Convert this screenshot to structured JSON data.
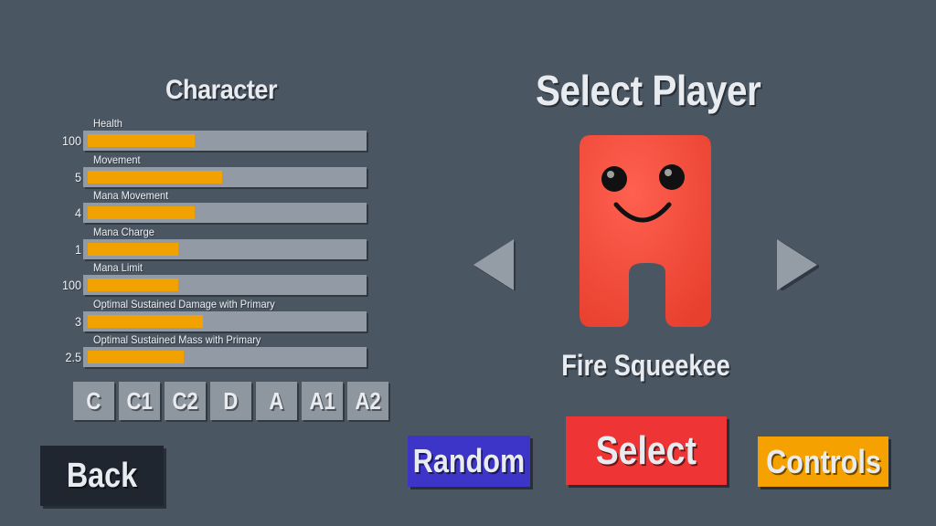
{
  "left_panel": {
    "title": "Character",
    "stats": [
      {
        "label": "Health",
        "value": "100",
        "fill": 0.39
      },
      {
        "label": "Movement",
        "value": "5",
        "fill": 0.49
      },
      {
        "label": "Mana Movement",
        "value": "4",
        "fill": 0.39
      },
      {
        "label": "Mana Charge",
        "value": "1",
        "fill": 0.33
      },
      {
        "label": "Mana Limit",
        "value": "100",
        "fill": 0.33
      },
      {
        "label": "Optimal Sustained Damage with Primary",
        "value": "3",
        "fill": 0.42
      },
      {
        "label": "Optimal Sustained Mass with Primary",
        "value": "2.5",
        "fill": 0.35
      }
    ],
    "tabs": [
      "C",
      "C1",
      "C2",
      "D",
      "A",
      "A1",
      "A2"
    ]
  },
  "back_button": {
    "label": "Back"
  },
  "right_panel": {
    "title": "Select Player",
    "character_name": "Fire Squeekee",
    "prev_icon": "triangle-left-icon",
    "next_icon": "triangle-right-icon"
  },
  "actions": {
    "random_label": "Random",
    "select_label": "Select",
    "controls_label": "Controls"
  },
  "colors": {
    "background": "#4b5663",
    "bar_fill": "#f2a200",
    "bar_track": "#929aa5",
    "character": "#f24c3c",
    "random": "#3d34c8",
    "select": "#ee3434",
    "controls": "#f5a100",
    "back": "#1f2630"
  }
}
